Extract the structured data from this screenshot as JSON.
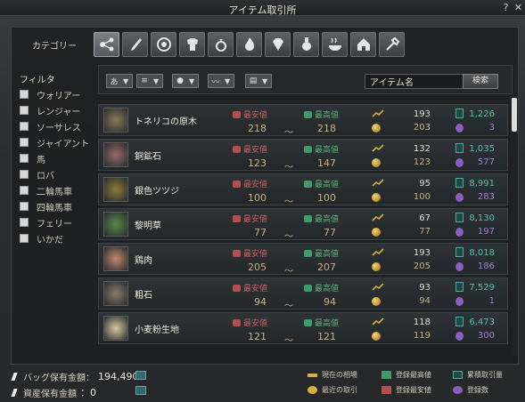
{
  "window": {
    "title": "アイテム取引所",
    "help_label": "?",
    "close_label": "✕"
  },
  "category": {
    "label": "カテゴリー",
    "icons": [
      "network-icon",
      "sword-icon",
      "shield-icon",
      "armor-icon",
      "ring-icon",
      "fire-icon",
      "gem-icon",
      "potion-icon",
      "cooking-icon",
      "house-icon",
      "tools-icon"
    ]
  },
  "filter": {
    "title": "フィルタ",
    "items": [
      "ウォリアー",
      "レンジャー",
      "ソーサレス",
      "ジャイアント",
      "馬",
      "ロバ",
      "二輪馬車",
      "四輪馬車",
      "フェリー",
      "いかだ"
    ]
  },
  "sort": {
    "buttons": [
      "あ",
      "≡",
      "●",
      "〰",
      "▤"
    ],
    "search_value": "アイテム名",
    "search_button": "検索"
  },
  "labels": {
    "min": "最安値",
    "max": "最高値",
    "tilde": "～"
  },
  "items": [
    {
      "name": "トネリコの原木",
      "min": "218",
      "max": "218",
      "current": "193",
      "recent": "203",
      "volume": "1,226",
      "registered": "3",
      "thumb": "#8a7a5a"
    },
    {
      "name": "銅鉱石",
      "min": "123",
      "max": "147",
      "current": "132",
      "recent": "123",
      "volume": "1,035",
      "registered": "577",
      "thumb": "#9a6a6a"
    },
    {
      "name": "銀色ツツジ",
      "min": "100",
      "max": "100",
      "current": "95",
      "recent": "100",
      "volume": "8,991",
      "registered": "283",
      "thumb": "#8c7a3a"
    },
    {
      "name": "黎明草",
      "min": "77",
      "max": "77",
      "current": "67",
      "recent": "77",
      "volume": "8,130",
      "registered": "197",
      "thumb": "#5a8a4a"
    },
    {
      "name": "鶏肉",
      "min": "205",
      "max": "207",
      "current": "193",
      "recent": "205",
      "volume": "8,018",
      "registered": "186",
      "thumb": "#c08870"
    },
    {
      "name": "粗石",
      "min": "94",
      "max": "94",
      "current": "93",
      "recent": "94",
      "volume": "7,529",
      "registered": "1",
      "thumb": "#8a7a6a"
    },
    {
      "name": "小麦粉生地",
      "min": "121",
      "max": "121",
      "current": "118",
      "recent": "119",
      "volume": "6,473",
      "registered": "300",
      "thumb": "#d8c8a0"
    }
  ],
  "footer": {
    "bag_label": "バッグ保有金額：",
    "bag_amount": "194,490",
    "bank_label": "資産保有金額",
    "bank_amount": "：0"
  },
  "legend": {
    "current_price": "現在の相場",
    "recent_trade": "最近の取引",
    "reg_max": "登録最高値",
    "reg_min": "登録最安値",
    "total_trades": "累積取引量",
    "reg_count": "登録数"
  },
  "colors": {
    "min": "#c76060",
    "max": "#5bb07a",
    "gold": "#c8b27a",
    "volume": "#5bbfa9",
    "registered": "#a27ed4"
  }
}
